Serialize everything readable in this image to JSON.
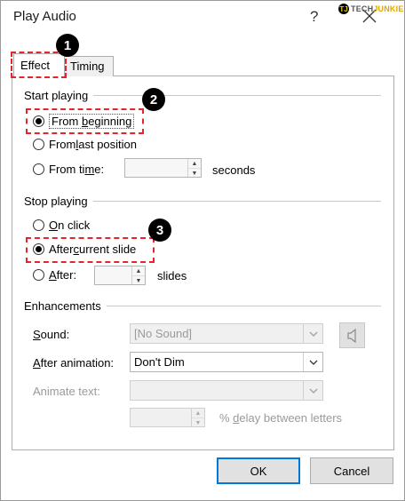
{
  "window": {
    "title": "Play Audio",
    "help": "?"
  },
  "watermark": {
    "logo": "TJ",
    "text_a": "TECH",
    "text_b": "JUNKIE"
  },
  "tabs": [
    {
      "label": "Effect",
      "selected": true
    },
    {
      "label": "Timing",
      "selected": false
    }
  ],
  "start_playing": {
    "heading": "Start playing",
    "options": [
      {
        "pre": "From ",
        "key": "b",
        "post": "eginning",
        "checked": true
      },
      {
        "pre": "From ",
        "key": "l",
        "post": "ast position",
        "checked": false
      },
      {
        "pre": "From ti",
        "key": "m",
        "post": "e:",
        "checked": false
      }
    ],
    "time_value": "",
    "seconds_label": "seconds"
  },
  "stop_playing": {
    "heading": "Stop playing",
    "options": [
      {
        "pre": "",
        "key": "O",
        "post": "n click",
        "checked": false
      },
      {
        "pre": "After ",
        "key": "c",
        "post": "urrent slide",
        "checked": true
      },
      {
        "pre": "",
        "key": "A",
        "post": "fter:",
        "checked": false
      }
    ],
    "slides_value": "",
    "slides_label": "slides"
  },
  "enhancements": {
    "heading": "Enhancements",
    "sound": {
      "key": "S",
      "label_rest": "ound:",
      "value": "[No Sound]"
    },
    "after_animation": {
      "key": "A",
      "label_rest": "fter animation:",
      "value": "Don't Dim"
    },
    "animate_text": {
      "label": "Animate text:",
      "value": ""
    },
    "delay": {
      "value": "",
      "pre": "% ",
      "key": "d",
      "post": "elay between letters"
    }
  },
  "buttons": {
    "ok": "OK",
    "cancel": "Cancel"
  },
  "annotations": [
    "1",
    "2",
    "3"
  ],
  "colors": {
    "annotation_red": "#e4262c",
    "ok_border": "#0078d7"
  }
}
